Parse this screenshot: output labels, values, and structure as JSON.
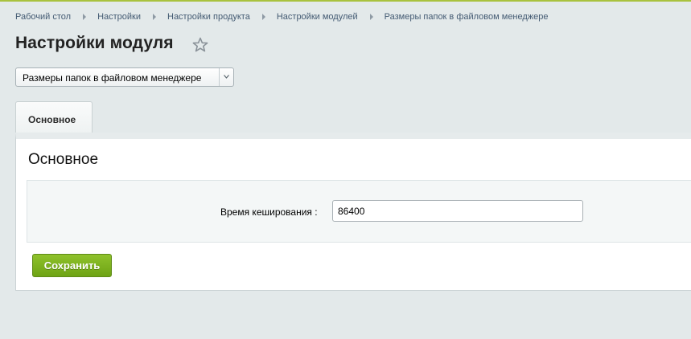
{
  "breadcrumb": {
    "items": [
      {
        "label": "Рабочий стол"
      },
      {
        "label": "Настройки"
      },
      {
        "label": "Настройки продукта"
      },
      {
        "label": "Настройки модулей"
      },
      {
        "label": "Размеры папок в файловом менеджере"
      }
    ]
  },
  "header": {
    "title": "Настройки модуля",
    "favorite_icon": "star-icon"
  },
  "module_select": {
    "value": "Размеры папок в файловом менеджере",
    "arrow_icon": "chevron-down-icon"
  },
  "tabs": [
    {
      "label": "Основное"
    }
  ],
  "panel": {
    "heading": "Основное",
    "fields": [
      {
        "label": "Время кеширования :",
        "value": "86400"
      }
    ],
    "save_label": "Сохранить"
  },
  "colors": {
    "accent_line": "#a9c23e",
    "save_button": "#7cb21f",
    "breadcrumb_link": "#445b73",
    "page_background": "#e3e9ea"
  }
}
